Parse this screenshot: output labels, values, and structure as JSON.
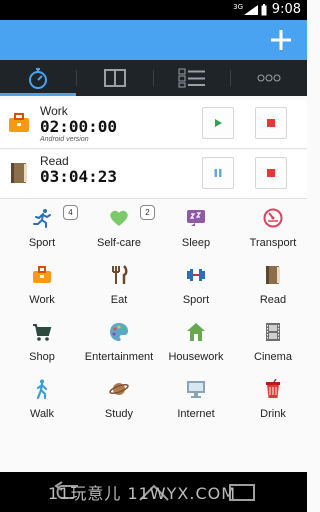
{
  "status_bar": {
    "time": "9:08",
    "network_label": "3G"
  },
  "colors": {
    "accent": "#4aa3f0",
    "tab_bg": "#1f2428",
    "play": "#2ea44f",
    "stop": "#e53935",
    "pause": "#64a8e8"
  },
  "tabs": [
    {
      "icon": "stopwatch-icon",
      "selected": true
    },
    {
      "icon": "book-icon",
      "selected": false
    },
    {
      "icon": "list-icon",
      "selected": false
    },
    {
      "icon": "more-icon",
      "selected": false
    }
  ],
  "timers": [
    {
      "name": "Work",
      "duration": "02:00:00",
      "subtitle": "Android version",
      "state": "stopped"
    },
    {
      "name": "Read",
      "duration": "03:04:23",
      "subtitle": "",
      "state": "running"
    }
  ],
  "activities": [
    {
      "label": "Sport",
      "icon": "runner-icon",
      "badge": "4"
    },
    {
      "label": "Self-care",
      "icon": "heart-icon",
      "badge": "2"
    },
    {
      "label": "Sleep",
      "icon": "sleep-icon",
      "badge": ""
    },
    {
      "label": "Transport",
      "icon": "gauge-icon",
      "badge": ""
    },
    {
      "label": "Work",
      "icon": "briefcase-icon",
      "badge": ""
    },
    {
      "label": "Eat",
      "icon": "fork-knife-icon",
      "badge": ""
    },
    {
      "label": "Sport",
      "icon": "dumbbell-icon",
      "badge": ""
    },
    {
      "label": "Read",
      "icon": "book-icon",
      "badge": ""
    },
    {
      "label": "Shop",
      "icon": "cart-icon",
      "badge": ""
    },
    {
      "label": "Entertainment",
      "icon": "palette-icon",
      "badge": ""
    },
    {
      "label": "Housework",
      "icon": "house-icon",
      "badge": ""
    },
    {
      "label": "Cinema",
      "icon": "film-icon",
      "badge": ""
    },
    {
      "label": "Walk",
      "icon": "walker-icon",
      "badge": ""
    },
    {
      "label": "Study",
      "icon": "planet-icon",
      "badge": ""
    },
    {
      "label": "Internet",
      "icon": "monitor-icon",
      "badge": ""
    },
    {
      "label": "Drink",
      "icon": "cup-icon",
      "badge": ""
    }
  ],
  "watermark": "11玩意儿 11WYX.COM"
}
